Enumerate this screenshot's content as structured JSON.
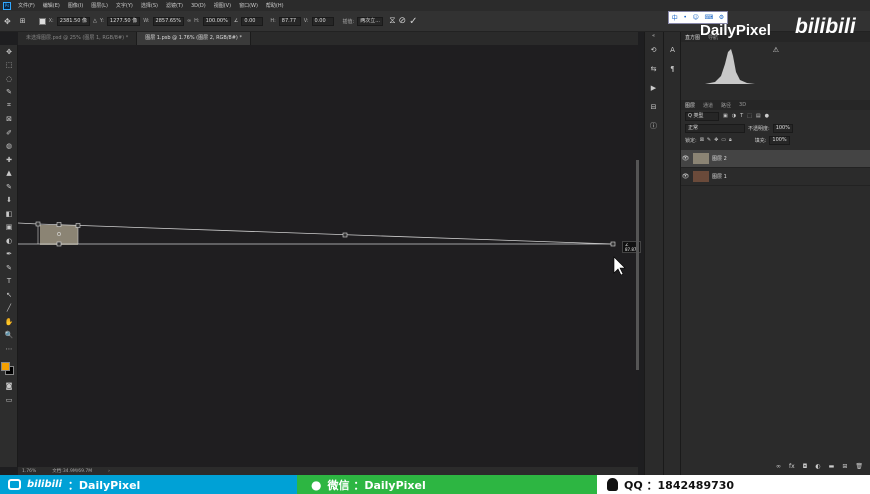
{
  "menubar": {
    "items": [
      "文件(F)",
      "编辑(E)",
      "图像(I)",
      "图层(L)",
      "文字(Y)",
      "选择(S)",
      "滤镜(T)",
      "3D(D)",
      "视图(V)",
      "窗口(W)",
      "帮助(H)"
    ]
  },
  "options": {
    "x_label": "X:",
    "x_value": "2381.50 像",
    "y_label": "Y:",
    "y_value": "1277.50 像",
    "w_label": "W:",
    "w_value": "2857.65%",
    "h_label": "H:",
    "h_value": "100.00%",
    "angle_value": "0.00",
    "h2_label": "H:",
    "h2_value": "87.77",
    "v_label": "V:",
    "v_value": "0.00",
    "interp_label": "插值:",
    "interp_value": "两次立..."
  },
  "tabs": [
    {
      "label": "未选择图层.psd @ 25% (图层 1, RGB/8#) *",
      "active": false
    },
    {
      "label": "图层 1.psb @ 1.76% (图层 2, RGB/8#) *",
      "active": true
    }
  ],
  "tools": [
    "✥",
    "⬚",
    "◌",
    "✎",
    "⌗",
    "⊠",
    "✐",
    "◍",
    "✚",
    "▲",
    "✎",
    "⬇",
    "◧",
    "▣",
    "◐",
    "✒",
    "✎",
    "T",
    "↖",
    "╱",
    "✋",
    "🔍",
    "⋯"
  ],
  "canvas": {
    "angle_readout": "∠ 87.87°"
  },
  "statusbar": {
    "zoom": "1.76%",
    "doc": "文档:34.9M/69.7M"
  },
  "right_panel": {
    "top_tabs": [
      "直方图",
      "导航"
    ],
    "layer_tabs": [
      "图层",
      "通道",
      "路径",
      "3D"
    ],
    "kind_label": "Q 类型",
    "blend_mode": "正常",
    "opacity_label": "不透明度:",
    "opacity_value": "100%",
    "lock_label": "锁定:",
    "fill_label": "填充:",
    "fill_value": "100%",
    "layers": [
      {
        "name": "图层 2",
        "selected": true
      },
      {
        "name": "图层 1",
        "selected": false
      }
    ]
  },
  "ime": {
    "items": [
      "中",
      "•",
      "☺",
      "⌨",
      "⚙"
    ]
  },
  "watermark": {
    "text": "DailyPixel",
    "bili": "bilibili"
  },
  "footer": {
    "bili_logo": "bilibili",
    "bili_text": "：DailyPixel",
    "wechat_text": "微信 ：DailyPixel",
    "qq_text": "QQ ：1842489730"
  },
  "colors": {
    "foreground": "#f5a000",
    "background": "#000000",
    "accent": "#31a8ff"
  }
}
